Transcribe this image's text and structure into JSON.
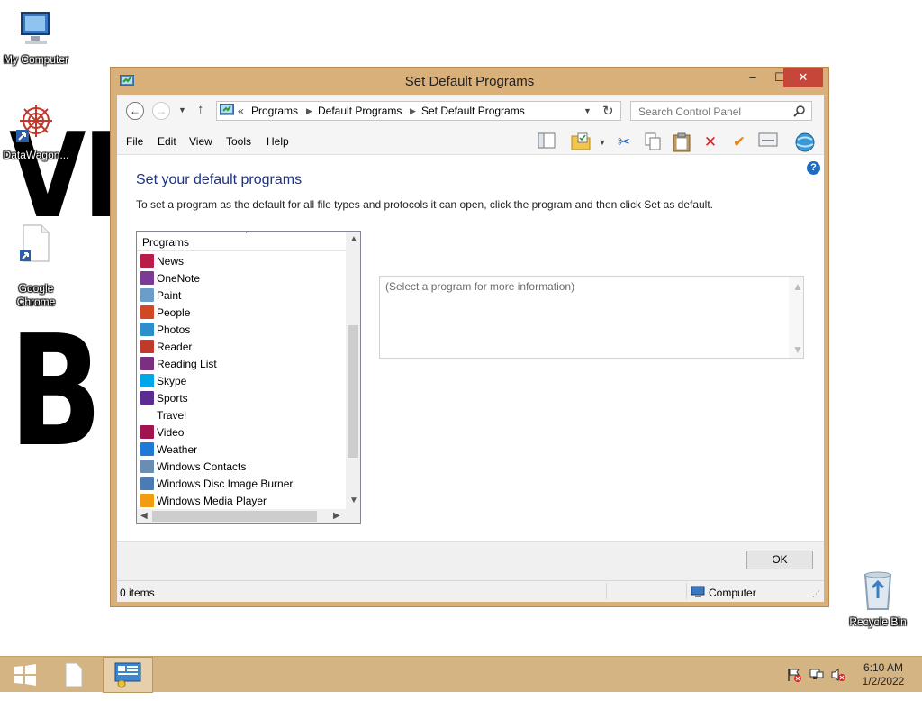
{
  "desktop": {
    "wallpaper_lines": [
      "VI",
      "BI"
    ],
    "icons": [
      {
        "label": "My Computer",
        "icon": "computer-icon"
      },
      {
        "label": "DataWagon...",
        "icon": "datawagon-icon"
      },
      {
        "label": "Google\nChrome",
        "icon": "file-shortcut-icon"
      },
      {
        "label": "Recycle Bin",
        "icon": "recycle-bin-icon"
      }
    ]
  },
  "window": {
    "title": "Set Default Programs",
    "controls": {
      "minimize": "–",
      "maximize": "☐",
      "close": "✕"
    },
    "breadcrumb": {
      "prefix": "«",
      "items": [
        "Programs",
        "Default Programs",
        "Set Default Programs"
      ]
    },
    "search": {
      "placeholder": "Search Control Panel"
    },
    "menu": [
      "File",
      "Edit",
      "View",
      "Tools",
      "Help"
    ],
    "toolbar_icons": [
      "layout-icon",
      "folder-options-icon",
      "cut-icon",
      "copy-icon",
      "paste-icon",
      "delete-icon",
      "checkmark-icon",
      "properties-icon",
      "globe-icon"
    ],
    "heading": "Set your default programs",
    "description": "To set a program as the default for all file types and protocols it can open, click the program and then click Set as default.",
    "list": {
      "header": "Programs",
      "items": [
        {
          "label": "News",
          "icon": "news-icon",
          "color": "#b91d47"
        },
        {
          "label": "OneNote",
          "icon": "onenote-icon",
          "color": "#7b3a96"
        },
        {
          "label": "Paint",
          "icon": "paint-icon",
          "color": "#6a9ec9"
        },
        {
          "label": "People",
          "icon": "people-icon",
          "color": "#d24726"
        },
        {
          "label": "Photos",
          "icon": "photos-icon",
          "color": "#2b8fc9"
        },
        {
          "label": "Reader",
          "icon": "reader-icon",
          "color": "#c1392b"
        },
        {
          "label": "Reading List",
          "icon": "reading-list-icon",
          "color": "#7a2f80"
        },
        {
          "label": "Skype",
          "icon": "skype-icon",
          "color": "#00a8e8"
        },
        {
          "label": "Sports",
          "icon": "sports-icon",
          "color": "#5b2c91"
        },
        {
          "label": "Travel",
          "icon": "travel-icon",
          "color": "#ffffff"
        },
        {
          "label": "Video",
          "icon": "video-icon",
          "color": "#a1154f"
        },
        {
          "label": "Weather",
          "icon": "weather-icon",
          "color": "#1e7ad6"
        },
        {
          "label": "Windows Contacts",
          "icon": "contacts-icon",
          "color": "#6c8db2"
        },
        {
          "label": "Windows Disc Image Burner",
          "icon": "disc-burner-icon",
          "color": "#4b7bb5"
        },
        {
          "label": "Windows Media Player",
          "icon": "media-player-icon",
          "color": "#f39c12"
        }
      ]
    },
    "info_text": "(Select a program for more information)",
    "ok_label": "OK",
    "status": {
      "items": "0 items",
      "location": "Computer"
    }
  },
  "taskbar": {
    "time": "6:10 AM",
    "date": "1/2/2022",
    "tray_icons": [
      "action-center-flag-icon",
      "network-icon",
      "volume-muted-icon"
    ]
  }
}
